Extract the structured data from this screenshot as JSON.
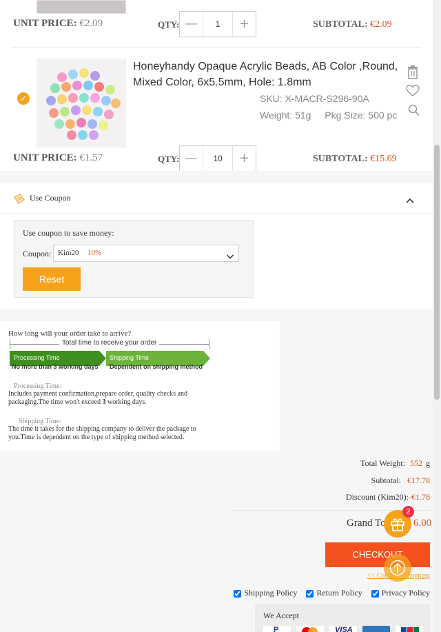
{
  "item1": {
    "unit_price_label": "UNIT PRICE:",
    "unit_price": "€2.09",
    "qty_label": "QTY:",
    "qty_minus": "—",
    "qty_value": "1",
    "qty_plus": "+",
    "subtotal_label": "SUBTOTAL:",
    "subtotal": "€2.09"
  },
  "item2": {
    "selected": true,
    "title": "Honeyhandy Opaque Acrylic Beads, AB Color ,Round, Mixed Color, 6x5.5mm, Hole: 1.8mm",
    "sku": "SKU: X-MACR-S296-90A",
    "weight": "Weight: 51g",
    "pkg_size": "Pkg Size: 500 pc",
    "unit_price_label": "UNIT PRICE:",
    "unit_price": "€1.57",
    "qty_label": "QTY:",
    "qty_minus": "—",
    "qty_value": "10",
    "qty_plus": "+",
    "subtotal_label": "SUBTOTAL:",
    "subtotal": "€15.69",
    "icons": [
      "trash-icon",
      "heart-icon",
      "search-icon"
    ]
  },
  "coupon": {
    "header": "Use Coupon",
    "hint": "Use coupon to save money:",
    "label": "Coupon:",
    "code": "Kim20",
    "percent": "10%",
    "reset_label": "Reset"
  },
  "delivery": {
    "question": "How long will your order take to arrive?",
    "total_time": "Total time to receive your order",
    "processing_arrow": "Processing Time",
    "shipping_arrow": "Shipping Time",
    "processing_caption": "No more than 3 working days",
    "shipping_caption": "Dependent on shipping method",
    "processing_title": "Processing Time:",
    "processing_text_a": "Includes payment confirmation,prepare order, quality checks and packaging.The time won't exceed ",
    "processing_text_b": "3",
    "processing_text_c": " working days.",
    "shipping_title": "Shipping Time:",
    "shipping_text": "The time it takes for the shipping company to deliver the package to you.Time is dependent on the type of shipping method selected."
  },
  "summary": {
    "total_weight_label": "Total Weight:",
    "total_weight_value": "552",
    "total_weight_unit": "g",
    "subtotal_label": "Subtotal:",
    "subtotal_value": "€17.78",
    "discount_label": "Discount (Kim20):",
    "discount_value": "-€1.78",
    "grand_total_label": "Grand To",
    "grand_total_value": "6.00",
    "checkout_label": "CHECKOUT",
    "continue_label": "<< Continue Shopping",
    "gift_badge": "2"
  },
  "policies": [
    {
      "label": "Shipping Policy",
      "checked": true
    },
    {
      "label": "Return Policy",
      "checked": true
    },
    {
      "label": "Privacy Policy",
      "checked": true
    }
  ],
  "payment": {
    "title": "We Accept",
    "cards": [
      "PayPal",
      "Mastercard",
      "VISA",
      "AMERICAN EXPRESS",
      "JCB"
    ]
  },
  "colors": {
    "accent_orange": "#f7a21b",
    "price_red": "#e0531f",
    "checkout_red": "#f4511e",
    "arrow_dark_green": "#3f8f1f",
    "arrow_light_green": "#6bb33a"
  }
}
